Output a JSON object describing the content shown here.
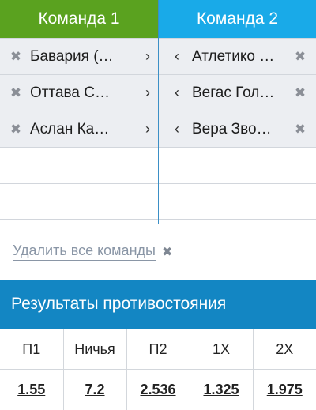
{
  "team1": {
    "header": "Команда 1",
    "items": [
      "Бавария (…",
      "Оттава С…",
      "Аслан Ка…"
    ],
    "header_color": "#5aa21f"
  },
  "team2": {
    "header": "Команда 2",
    "items": [
      "Атлетико …",
      "Вегас Гол…",
      "Вера Зво…"
    ],
    "header_color": "#19aae8"
  },
  "icons": {
    "remove": "✖",
    "move_right": "›",
    "move_left": "‹"
  },
  "delete_all": {
    "label": "Удалить все команды",
    "icon": "✖"
  },
  "results": {
    "title": "Результаты противостояния",
    "columns": [
      "П1",
      "Ничья",
      "П2",
      "1Х",
      "2Х"
    ],
    "values": [
      "1.55",
      "7.2",
      "2.536",
      "1.325",
      "1.975"
    ],
    "header_color": "#1386c3"
  }
}
